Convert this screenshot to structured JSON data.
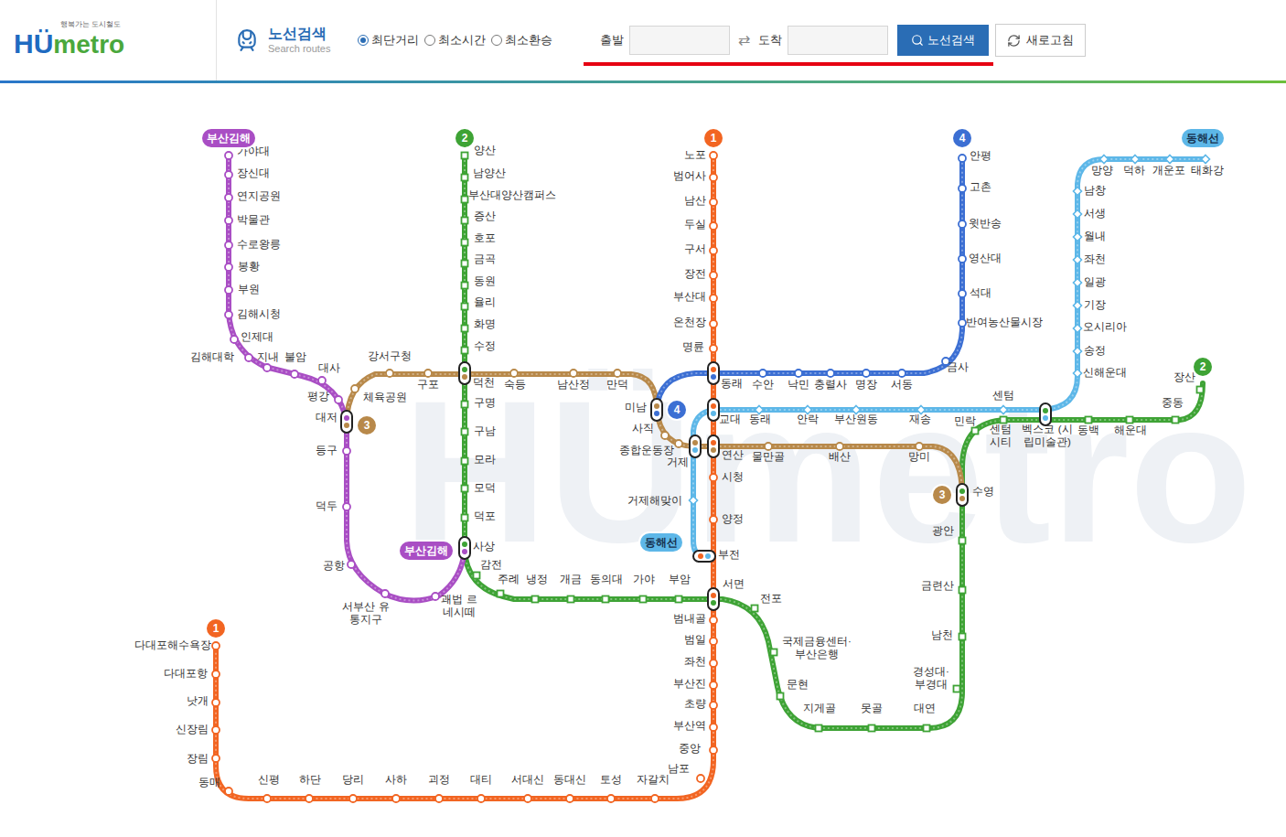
{
  "header": {
    "logo": {
      "tagline": "행복가는 도시철도",
      "mark": "HÜ",
      "word": "metro"
    },
    "title": "노선검색",
    "subtitle": "Search routes",
    "route_options": [
      {
        "label": "최단거리",
        "selected": true
      },
      {
        "label": "최소시간",
        "selected": false
      },
      {
        "label": "최소환승",
        "selected": false
      }
    ],
    "from": {
      "label": "출발",
      "value": ""
    },
    "swap": "⇄",
    "to": {
      "label": "도착",
      "value": ""
    },
    "search_button": "노선검색",
    "refresh_button": "새로고침"
  },
  "map": {
    "watermark": "HÜmetro",
    "lines": [
      {
        "badge": "1",
        "color": "#f26522",
        "kind": "circle",
        "stations": [
          {
            "name": "노포"
          },
          {
            "name": "범어사"
          },
          {
            "name": "남산"
          },
          {
            "name": "두실"
          },
          {
            "name": "구서"
          },
          {
            "name": "장전"
          },
          {
            "name": "부산대"
          },
          {
            "name": "온천장"
          },
          {
            "name": "명륜"
          },
          {
            "name": "시청"
          },
          {
            "name": "양정"
          },
          {
            "name": "범내골"
          },
          {
            "name": "범일"
          },
          {
            "name": "좌천"
          },
          {
            "name": "부산진"
          },
          {
            "name": "초량"
          },
          {
            "name": "부산역"
          },
          {
            "name": "중앙"
          },
          {
            "name": "남포"
          },
          {
            "name": "자갈치"
          },
          {
            "name": "토성"
          },
          {
            "name": "동대신"
          },
          {
            "name": "서대신"
          },
          {
            "name": "대티"
          },
          {
            "name": "괴정"
          },
          {
            "name": "사하"
          },
          {
            "name": "당리"
          },
          {
            "name": "하단"
          },
          {
            "name": "신평"
          },
          {
            "name": "동매"
          },
          {
            "name": "장림"
          },
          {
            "name": "신장림"
          },
          {
            "name": "낫개"
          },
          {
            "name": "다대포항"
          },
          {
            "name": "다대포해수욕장"
          }
        ]
      },
      {
        "badge": "2",
        "color": "#3ea335",
        "kind": "square",
        "stations": [
          {
            "name": "양산"
          },
          {
            "name": "남양산"
          },
          {
            "name": "부산대양산캠퍼스"
          },
          {
            "name": "증산"
          },
          {
            "name": "호포"
          },
          {
            "name": "금곡"
          },
          {
            "name": "동원"
          },
          {
            "name": "율리"
          },
          {
            "name": "화명"
          },
          {
            "name": "수정"
          },
          {
            "name": "구명"
          },
          {
            "name": "구남"
          },
          {
            "name": "모라"
          },
          {
            "name": "모덕"
          },
          {
            "name": "덕포"
          },
          {
            "name": "감전"
          },
          {
            "name": "주례"
          },
          {
            "name": "냉정"
          },
          {
            "name": "개금"
          },
          {
            "name": "동의대"
          },
          {
            "name": "가야"
          },
          {
            "name": "부암"
          },
          {
            "name": "전포"
          },
          {
            "name": "국제금융센터·부산은행"
          },
          {
            "name": "문현"
          },
          {
            "name": "지게골"
          },
          {
            "name": "못골"
          },
          {
            "name": "대연"
          },
          {
            "name": "경성대·부경대"
          },
          {
            "name": "남천"
          },
          {
            "name": "금련산"
          },
          {
            "name": "광안"
          },
          {
            "name": "민락"
          },
          {
            "name": "센텀 시티"
          },
          {
            "name": "동백"
          },
          {
            "name": "해운대"
          },
          {
            "name": "중동"
          },
          {
            "name": "장산"
          }
        ]
      },
      {
        "badge": "3",
        "color": "#b8894a",
        "kind": "circle",
        "stations": [
          {
            "name": "체육공원"
          },
          {
            "name": "강서구청"
          },
          {
            "name": "구포"
          },
          {
            "name": "숙등"
          },
          {
            "name": "남산정"
          },
          {
            "name": "만덕"
          },
          {
            "name": "사직"
          },
          {
            "name": "종합운동장"
          },
          {
            "name": "물만골"
          },
          {
            "name": "배산"
          },
          {
            "name": "망미"
          }
        ]
      },
      {
        "badge": "4",
        "color": "#3c6fd3",
        "kind": "circle",
        "stations": [
          {
            "name": "수안"
          },
          {
            "name": "낙민"
          },
          {
            "name": "충렬사"
          },
          {
            "name": "명장"
          },
          {
            "name": "서동"
          },
          {
            "name": "금사"
          },
          {
            "name": "반여농산물시장"
          },
          {
            "name": "석대"
          },
          {
            "name": "영산대"
          },
          {
            "name": "윗반송"
          },
          {
            "name": "고촌"
          },
          {
            "name": "안평"
          }
        ]
      },
      {
        "badge": "부산김해",
        "color": "#a94ec4",
        "kind": "circle",
        "stations": [
          {
            "name": "가야대"
          },
          {
            "name": "장신대"
          },
          {
            "name": "연지공원"
          },
          {
            "name": "박물관"
          },
          {
            "name": "수로왕릉"
          },
          {
            "name": "봉황"
          },
          {
            "name": "부원"
          },
          {
            "name": "김해시청"
          },
          {
            "name": "인제대"
          },
          {
            "name": "김해대학"
          },
          {
            "name": "지내"
          },
          {
            "name": "불암"
          },
          {
            "name": "대사"
          },
          {
            "name": "평강"
          },
          {
            "name": "등구"
          },
          {
            "name": "덕두"
          },
          {
            "name": "공항"
          },
          {
            "name": "서부산 유통지구"
          },
          {
            "name": "괘법 르네시떼"
          }
        ]
      },
      {
        "badge": "동해선",
        "color": "#5db7e8",
        "kind": "diamond",
        "stations": [
          {
            "name": "거제해맞이"
          },
          {
            "name": "동래"
          },
          {
            "name": "안락"
          },
          {
            "name": "부산원동"
          },
          {
            "name": "재송"
          },
          {
            "name": "센텀"
          },
          {
            "name": "신해운대"
          },
          {
            "name": "송정"
          },
          {
            "name": "오시리아"
          },
          {
            "name": "기장"
          },
          {
            "name": "일광"
          },
          {
            "name": "좌천"
          },
          {
            "name": "월내"
          },
          {
            "name": "서생"
          },
          {
            "name": "남창"
          },
          {
            "name": "망양"
          },
          {
            "name": "덕하"
          },
          {
            "name": "개운포"
          },
          {
            "name": "태화강"
          }
        ]
      }
    ],
    "transfers": [
      {
        "name": "동래",
        "colors": [
          "#f26522",
          "#3c6fd3"
        ]
      },
      {
        "name": "교대",
        "colors": [
          "#f26522",
          "#5db7e8"
        ]
      },
      {
        "name": "연산",
        "colors": [
          "#f26522",
          "#b8894a"
        ]
      },
      {
        "name": "부전",
        "colors": [
          "#f26522",
          "#5db7e8"
        ]
      },
      {
        "name": "서면",
        "colors": [
          "#f26522",
          "#3ea335"
        ]
      },
      {
        "name": "덕천",
        "colors": [
          "#3ea335",
          "#b8894a"
        ]
      },
      {
        "name": "사상",
        "colors": [
          "#3ea335",
          "#a94ec4"
        ]
      },
      {
        "name": "대저",
        "colors": [
          "#a94ec4",
          "#b8894a"
        ]
      },
      {
        "name": "미남",
        "colors": [
          "#b8894a",
          "#3c6fd3"
        ]
      },
      {
        "name": "거제",
        "colors": [
          "#b8894a",
          "#5db7e8"
        ]
      },
      {
        "name": "수영",
        "colors": [
          "#3ea335",
          "#b8894a"
        ]
      },
      {
        "name": "벡스코 (시립미술관)",
        "colors": [
          "#3ea335",
          "#5db7e8"
        ]
      }
    ]
  }
}
